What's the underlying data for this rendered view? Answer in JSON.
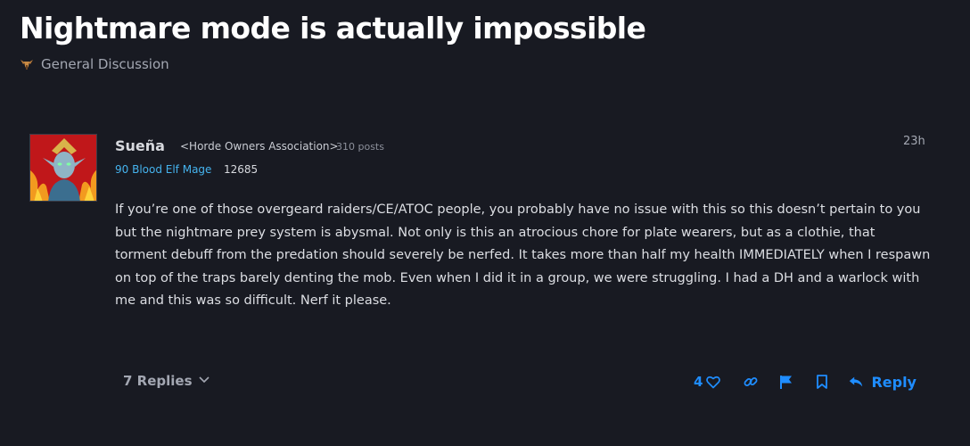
{
  "topic": {
    "title": "Nightmare mode is actually impossible",
    "category": "General Discussion"
  },
  "post": {
    "author": "Sueña",
    "guild": "<Horde Owners Association>",
    "post_count": "310 posts",
    "character": "90 Blood Elf Mage",
    "achievement_points": "12685",
    "time": "23h",
    "body": "If you’re one of those overgeard raiders/CE/ATOC people, you probably have no issue with this so this doesn’t pertain to you but the nightmare prey system is abysmal. Not only is this an atrocious chore for plate wearers, but as a clothie, that torment debuff from the predation should severely be nerfed. It takes more than half my health IMMEDIATELY when I respawn on top of the traps barely denting the mob. Even when I did it in a group, we were struggling. I had a DH and a warlock with me and this was so difficult. Nerf it please."
  },
  "footer": {
    "replies_label": "7 Replies",
    "like_count": "4",
    "reply_label": "Reply"
  },
  "icons": {
    "category": "horde-emblem-icon",
    "replies": "chevron-down-icon",
    "like": "heart-icon",
    "link": "link-icon",
    "flag": "flag-icon",
    "bookmark": "bookmark-icon",
    "reply": "reply-arrow-icon"
  },
  "colors": {
    "background": "#181a22",
    "accent": "#1f8dff",
    "class_text": "#45b3ee",
    "muted": "#a3a7b2"
  }
}
